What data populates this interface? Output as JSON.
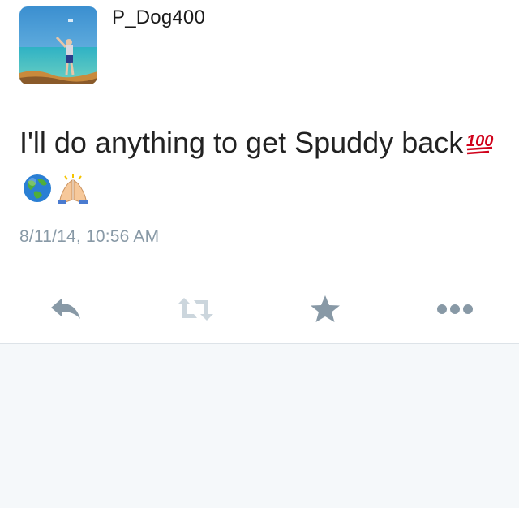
{
  "user": {
    "username": "P_Dog400"
  },
  "tweet": {
    "text": "I'll do anything to get Spuddy back",
    "emojis": [
      "hundred-points-emoji",
      "globe-emoji",
      "folded-hands-emoji"
    ],
    "timestamp": "8/11/14, 10:56 AM"
  },
  "actions": [
    {
      "name": "reply",
      "icon": "reply-arrow-icon"
    },
    {
      "name": "retweet",
      "icon": "retweet-icon"
    },
    {
      "name": "favorite",
      "icon": "star-icon"
    },
    {
      "name": "more",
      "icon": "more-dots-icon"
    }
  ],
  "colors": {
    "icon_gray": "#8899a6",
    "icon_light": "#ccd6dd",
    "text": "#222222",
    "timestamp": "#8899a6",
    "background": "#f5f8fa"
  }
}
